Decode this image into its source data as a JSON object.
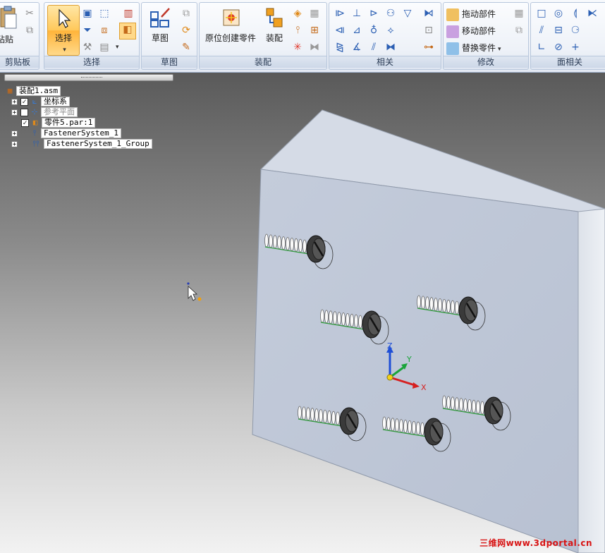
{
  "ribbon": {
    "clipboard": {
      "paste_label": "粘贴",
      "group_label": "剪贴板"
    },
    "select": {
      "select_label": "选择",
      "group_label": "选择"
    },
    "sketch": {
      "sketch_label": "草图",
      "group_label": "草图"
    },
    "assembly": {
      "create_in_place_label": "原位创建零件",
      "assemble_label": "装配",
      "group_label": "装配"
    },
    "relations": {
      "group_label": "相关"
    },
    "modify": {
      "drag_component_label": "拖动部件",
      "move_component_label": "移动部件",
      "replace_part_label": "替换零件",
      "group_label": "修改"
    },
    "face_relations": {
      "group_label": "面相关"
    }
  },
  "tree": {
    "root": "装配1.asm",
    "items": [
      {
        "label": "坐标系"
      },
      {
        "label": "参考平面"
      },
      {
        "label": "零件5.par:1"
      },
      {
        "label": "FastenerSystem_1"
      },
      {
        "label": "FastenerSystem_1_Group"
      }
    ]
  },
  "triad": {
    "z": "Z",
    "y": "Y",
    "x": "X"
  },
  "watermark": "三维网www.3dportal.cn"
}
